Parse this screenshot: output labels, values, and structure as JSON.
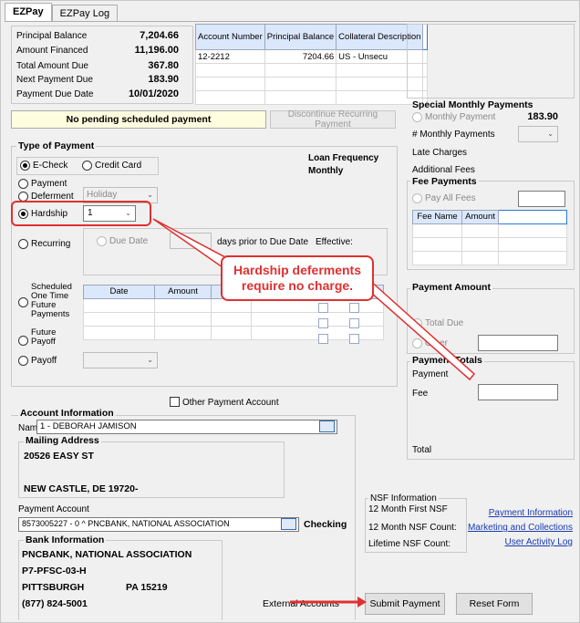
{
  "tabs": [
    "EZPay",
    "EZPay Log"
  ],
  "summary": {
    "principal_balance_label": "Principal Balance",
    "principal_balance": "7,204.66",
    "amount_financed_label": "Amount Financed",
    "amount_financed": "11,196.00",
    "total_due_label": "Total Amount Due",
    "total_due": "367.80",
    "next_payment_label": "Next Payment Due",
    "next_payment": "183.90",
    "due_date_label": "Payment Due Date",
    "due_date": "10/01/2020"
  },
  "account_grid": {
    "headers": [
      "Account Number",
      "Principal Balance",
      "Collateral Description"
    ],
    "rows": [
      [
        "12-2212",
        "7204.66",
        "US - Unsecu"
      ]
    ]
  },
  "pending_message": "No pending scheduled payment",
  "discontinue_button": "Discontinue Recurring Payment",
  "special": {
    "title": "Special Monthly Payments",
    "monthly_payment_label": "Monthly Payment",
    "monthly_payment": "183.90",
    "num_monthly_label": "# Monthly Payments",
    "late_charges_label": "Late Charges",
    "additional_fees_label": "Additional Fees"
  },
  "fees": {
    "title": "Fee Payments",
    "pay_all_label": "Pay All Fees",
    "headers": [
      "Fee Name",
      "Amount"
    ]
  },
  "payment_type": {
    "title": "Type of Payment",
    "loan_frequency_label": "Loan Frequency",
    "loan_frequency_value": "Monthly",
    "echeck": "E-Check",
    "credit_card": "Credit Card",
    "payment": "Payment",
    "deferment": "Deferment",
    "deferment_value": "Holiday",
    "hardship": "Hardship",
    "hardship_value": "1",
    "recurring": "Recurring",
    "due_date": "Due Date",
    "days_prior": "days prior to Due Date",
    "effective": "Effective:",
    "scheduled": "Scheduled One Time Future Payments",
    "future_payoff": "Future Payoff",
    "payoff": "Payoff",
    "sched_headers": [
      "Date",
      "Amount"
    ]
  },
  "callout_text": "Hardship deferments require no charge.",
  "payment_amount": {
    "title": "Payment Amount",
    "total_due": "Total Due",
    "other": "Other"
  },
  "payment_totals": {
    "title": "Payment Totals",
    "payment_label": "Payment",
    "fee_label": "Fee",
    "total_label": "Total"
  },
  "other_payment_account": "Other Payment Account",
  "account_info": {
    "title": "Account Information",
    "name_label": "Name",
    "name_value": "1 - DEBORAH JAMISON",
    "mailing_title": "Mailing Address",
    "address1": "20526 EASY ST",
    "address2": "NEW CASTLE, DE  19720-",
    "payment_account_label": "Payment Account",
    "payment_account_value": "8573005227 - 0 ^ PNCBANK, NATIONAL ASSOCIATION",
    "checking": "Checking"
  },
  "bank_info": {
    "title": "Bank Information",
    "line1": "PNCBANK, NATIONAL ASSOCIATION",
    "line2": "P7-PFSC-03-H",
    "city": "PITTSBURGH",
    "state_zip": "PA 15219",
    "phone": "(877) 824-5001"
  },
  "nsf": {
    "title": "NSF Information",
    "first": "12 Month First NSF",
    "count12": "12 Month NSF Count:",
    "lifetime": "Lifetime NSF Count:"
  },
  "links": [
    "Payment Information",
    "Marketing and Collections",
    "User Activity Log"
  ],
  "external_accounts": "External Accounts",
  "submit": "Submit Payment",
  "reset": "Reset Form",
  "colors": {
    "accent_red": "#e03030",
    "grid_header": "#dbe7fb",
    "link_blue": "#1a3ab3"
  }
}
